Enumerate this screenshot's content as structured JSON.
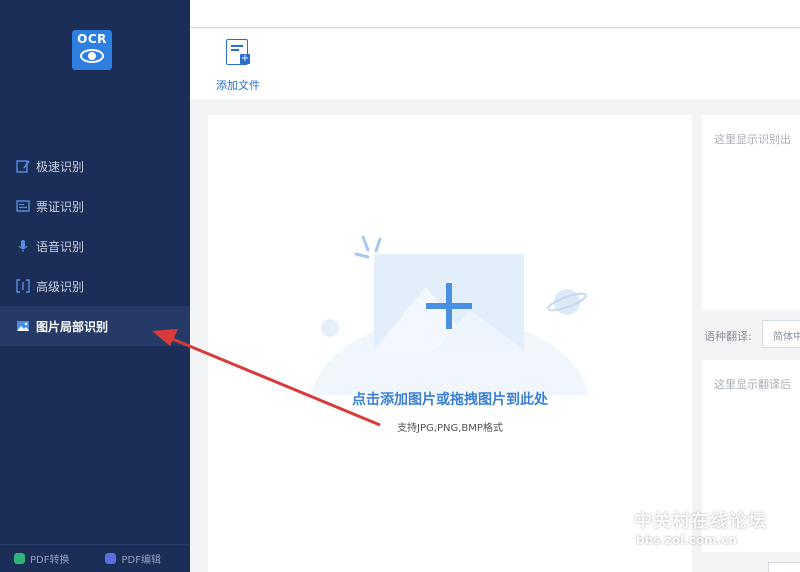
{
  "sidebar": {
    "logo_text": "OCR",
    "items": [
      {
        "label": "极速识别",
        "icon": "speed-scan-icon"
      },
      {
        "label": "票证识别",
        "icon": "ticket-icon"
      },
      {
        "label": "语音识别",
        "icon": "microphone-icon"
      },
      {
        "label": "高级识别",
        "icon": "advanced-scan-icon"
      },
      {
        "label": "图片局部识别",
        "icon": "image-icon",
        "active": true
      }
    ],
    "footer": [
      {
        "label": "PDF转换",
        "icon": "pdf-convert-icon",
        "color": "#2fb37a"
      },
      {
        "label": "PDF编辑",
        "icon": "pdf-edit-icon",
        "color": "#5a6ee0"
      }
    ]
  },
  "toolbar": {
    "add_file_label": "添加文件"
  },
  "upload": {
    "title": "点击添加图片或拖拽图片到此处",
    "subtitle": "支持JPG,PNG,BMP格式"
  },
  "result": {
    "placeholder_top": "这里显示识别出",
    "translate_label": "语种翻译:",
    "translate_value": "简体中",
    "placeholder_bottom": "这里显示翻译后"
  },
  "watermark": {
    "main": "中关村在线论坛",
    "url": "bbs.zol.com.cn"
  },
  "colors": {
    "sidebar_bg": "#1b2e57",
    "accent": "#2f7fe0",
    "annotation_arrow": "#d93a3a"
  }
}
